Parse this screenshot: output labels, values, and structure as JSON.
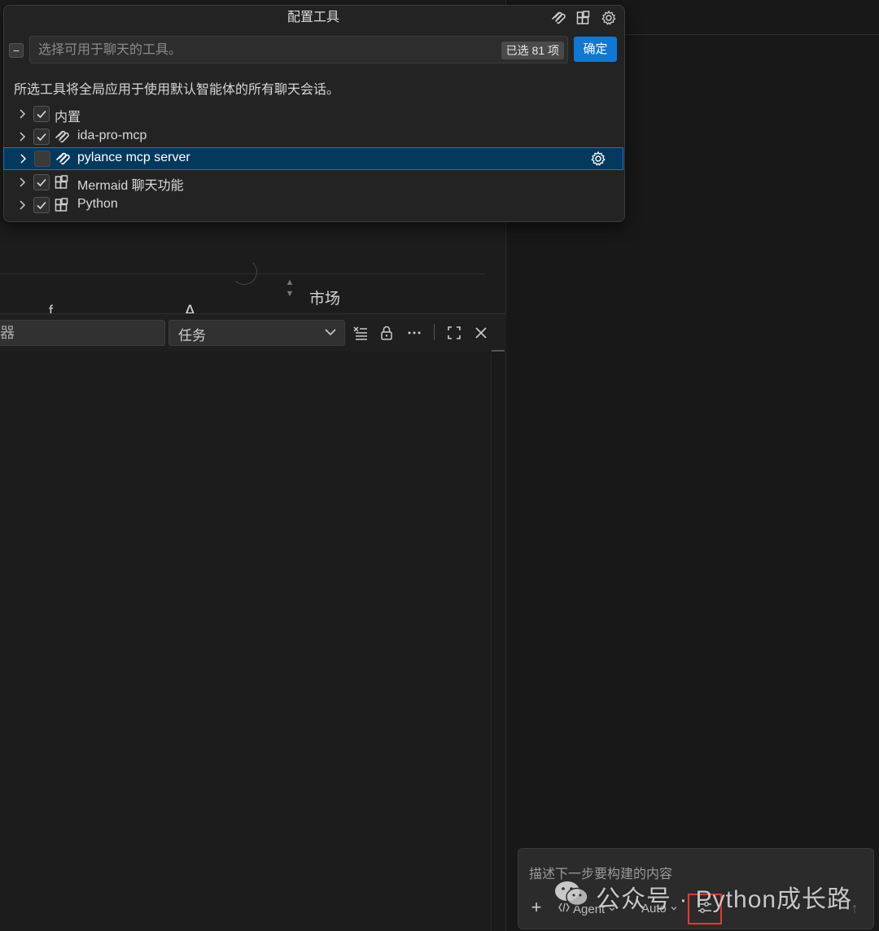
{
  "popup": {
    "title": "配置工具",
    "search_placeholder": "选择可用于聊天的工具。",
    "selected_count": "已选 81 项",
    "ok_label": "确定",
    "description": "所选工具将全局应用于使用默认智能体的所有聊天会话。",
    "title_icons": [
      "mcp-icon",
      "extensions-icon",
      "gear-icon"
    ],
    "tools": [
      {
        "label": "内置",
        "checked": true,
        "icon": "none"
      },
      {
        "label": "ida-pro-mcp",
        "checked": true,
        "icon": "mcp-icon"
      },
      {
        "label": "pylance mcp server",
        "checked": false,
        "icon": "mcp-icon",
        "selected": true
      },
      {
        "label": "Mermaid 聊天功能",
        "checked": true,
        "icon": "extensions-icon"
      },
      {
        "label": "Python",
        "checked": true,
        "icon": "extensions-icon"
      }
    ]
  },
  "editor": {
    "market_label": "市场",
    "fragment_1": "f",
    "fragment_2": "A"
  },
  "panel": {
    "filter_value": "器",
    "task_select_value": "任务"
  },
  "chat": {
    "placeholder": "描述下一步要构建的内容",
    "agent_label": "Agent",
    "auto_label": "Auto"
  },
  "watermark": {
    "text": "公众号 · Python成长路"
  },
  "colors": {
    "accent": "#0e78d4",
    "selection": "#04395e",
    "highlight_box": "#e53935"
  }
}
